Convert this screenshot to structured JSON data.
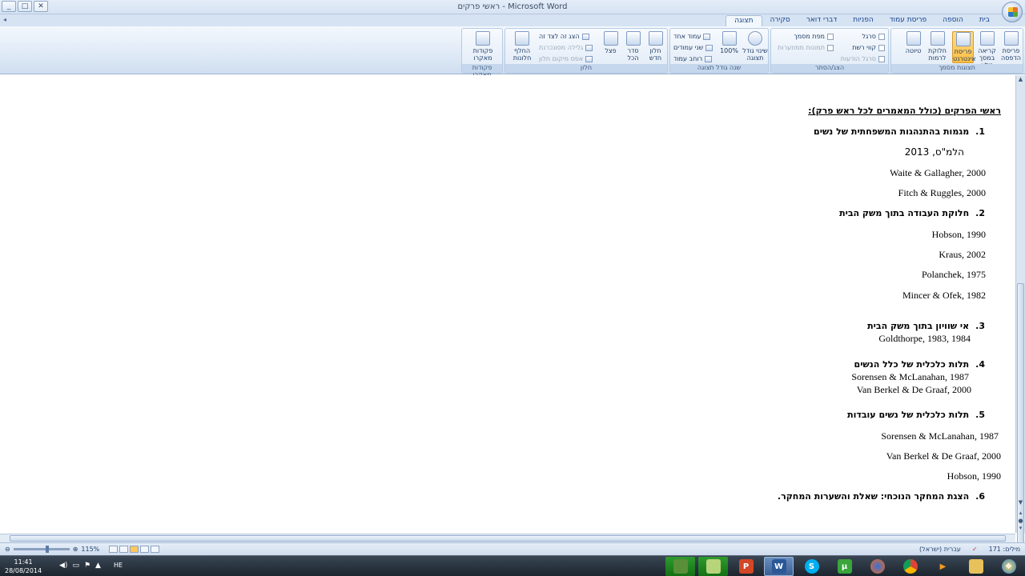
{
  "window": {
    "title": "ראשי פרקים - Microsoft Word",
    "min_label": "_",
    "max_label": "□",
    "close_label": "✕"
  },
  "tabs": [
    "בית",
    "הוספה",
    "פריסת עמוד",
    "הפניות",
    "דברי דואר",
    "סקירה",
    "תצוגה"
  ],
  "active_tab": "תצוגה",
  "ribbon": {
    "group_views": {
      "label": "תצוגות מסמך",
      "buttons": [
        "פריסת הדפסה",
        "קריאה במסך מלא",
        "פריסת אינטרנט",
        "חלוקת לרמות",
        "טיוטה"
      ]
    },
    "group_show": {
      "label": "הצג/הסתר",
      "items": [
        "סרגל",
        "קווי רשת",
        "סרגל הודעות",
        "מפת מסמך",
        "תמונות ממוזערות"
      ]
    },
    "group_zoom": {
      "label": "שנה גודל תצוגה",
      "zoom_button": "שינוי גודל תצוגה",
      "percent": "100%",
      "items": [
        "עמוד אחד",
        "שני עמודים",
        "רוחב עמוד"
      ]
    },
    "group_window": {
      "label": "חלון",
      "buttons": [
        "חלון חדש",
        "סדר הכל",
        "פצל"
      ],
      "items": [
        "הצג זה לצד זה",
        "גלילה מסונכרנת",
        "אפס מיקום חלון"
      ],
      "switch": "החלף חלונות"
    },
    "group_macros": {
      "label": "פקודות מאקרו",
      "button": "פקודות מאקרו"
    }
  },
  "document": {
    "heading": "ראשי הפרקים (כולל המאמרים לכל ראש פרק):",
    "sections": [
      {
        "num": "1.",
        "title": "מגמות בהתנהגות המשפחתית של נשים"
      },
      {
        "num": "2.",
        "title": "חלוקת העבודה בתוך משק הבית"
      },
      {
        "num": "3.",
        "title": "אי שוויון בתוך משק הבית"
      },
      {
        "num": "4.",
        "title": "תלות כלכלית של כלל הנשים"
      },
      {
        "num": "5.",
        "title": "תלות כלכלית של נשים עובדות"
      },
      {
        "num": "6.",
        "title": "הצגת המחקר הנוכחי: שאלת והשערות המחקר."
      }
    ],
    "refs": {
      "s1_a": "הלמ\"ס, 2013",
      "s1_b": "Waite & Gallagher, 2000",
      "s1_c": "Fitch & Ruggles, 2000",
      "s2_a": "Hobson, 1990",
      "s2_b": "Kraus, 2002",
      "s2_c": "Polanchek, 1975",
      "s2_d": "Mincer & Ofek, 1982",
      "s3_a": "Goldthorpe, 1983, 1984",
      "s4_a": "Sorensen & McLanahan, 1987",
      "s4_b": "Van Berkel & De Graaf, 2000",
      "s5_a": "Sorensen & McLanahan, 1987",
      "s5_b": "Van Berkel & De Graaf, 2000",
      "s5_c": "Hobson, 1990"
    }
  },
  "status": {
    "words": "מילים: 171",
    "language": "עברית (ישראל)",
    "zoom": "115%"
  },
  "taskbar": {
    "time": "11:41",
    "date": "28/08/2014",
    "lang": "HE"
  }
}
